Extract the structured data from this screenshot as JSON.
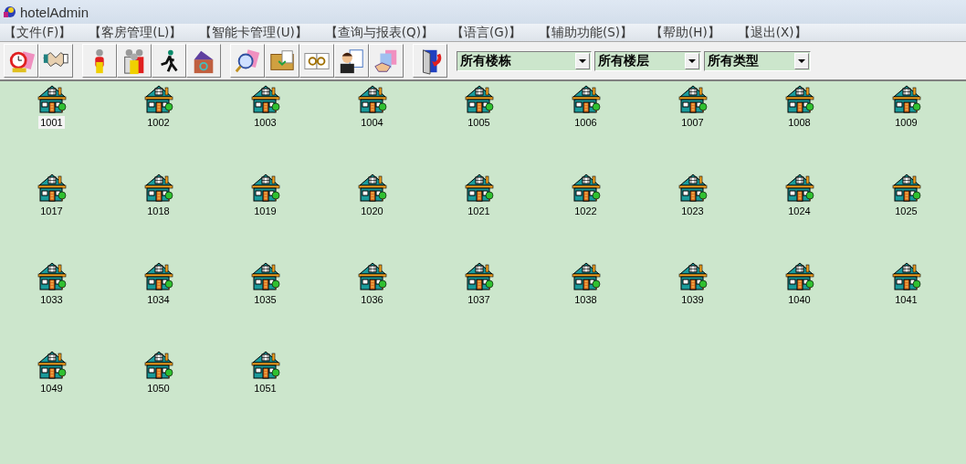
{
  "window": {
    "title": "hotelAdmin"
  },
  "menu": [
    "【文件(F)】",
    "【客房管理(L)】",
    "【智能卡管理(U)】",
    "【查询与报表(Q)】",
    "【语言(G)】",
    "【辅助功能(S)】",
    "【帮助(H)】",
    "【退出(X)】"
  ],
  "filters": [
    {
      "value": "所有楼栋"
    },
    {
      "value": "所有楼层"
    },
    {
      "value": "所有类型"
    }
  ],
  "rooms": [
    {
      "number": "1001",
      "selected": true
    },
    {
      "number": "1002",
      "selected": false
    },
    {
      "number": "1003",
      "selected": false
    },
    {
      "number": "1004",
      "selected": false
    },
    {
      "number": "1005",
      "selected": false
    },
    {
      "number": "1006",
      "selected": false
    },
    {
      "number": "1007",
      "selected": false
    },
    {
      "number": "1008",
      "selected": false
    },
    {
      "number": "1009",
      "selected": false
    },
    {
      "number": "1017",
      "selected": false
    },
    {
      "number": "1018",
      "selected": false
    },
    {
      "number": "1019",
      "selected": false
    },
    {
      "number": "1020",
      "selected": false
    },
    {
      "number": "1021",
      "selected": false
    },
    {
      "number": "1022",
      "selected": false
    },
    {
      "number": "1023",
      "selected": false
    },
    {
      "number": "1024",
      "selected": false
    },
    {
      "number": "1025",
      "selected": false
    },
    {
      "number": "1033",
      "selected": false
    },
    {
      "number": "1034",
      "selected": false
    },
    {
      "number": "1035",
      "selected": false
    },
    {
      "number": "1036",
      "selected": false
    },
    {
      "number": "1037",
      "selected": false
    },
    {
      "number": "1038",
      "selected": false
    },
    {
      "number": "1039",
      "selected": false
    },
    {
      "number": "1040",
      "selected": false
    },
    {
      "number": "1041",
      "selected": false
    },
    {
      "number": "1049",
      "selected": false
    },
    {
      "number": "1050",
      "selected": false
    },
    {
      "number": "1051",
      "selected": false
    }
  ]
}
